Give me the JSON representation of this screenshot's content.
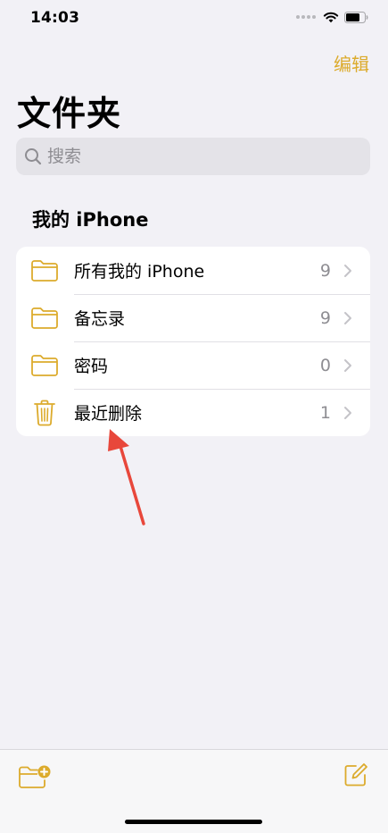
{
  "status_bar": {
    "time": "14:03"
  },
  "header": {
    "edit_label": "编辑",
    "title": "文件夹"
  },
  "search": {
    "placeholder": "搜索",
    "value": ""
  },
  "section": {
    "title": "我的 iPhone"
  },
  "folders": [
    {
      "label": "所有我的 iPhone",
      "count": "9",
      "icon": "folder-icon"
    },
    {
      "label": "备忘录",
      "count": "9",
      "icon": "folder-icon"
    },
    {
      "label": "密码",
      "count": "0",
      "icon": "folder-icon"
    },
    {
      "label": "最近删除",
      "count": "1",
      "icon": "trash-icon"
    }
  ],
  "toolbar": {
    "new_folder_icon": "new-folder-icon",
    "compose_icon": "compose-icon"
  },
  "colors": {
    "accent": "#dcab2c",
    "background": "#f2f1f6",
    "annotation": "#e8473b"
  }
}
